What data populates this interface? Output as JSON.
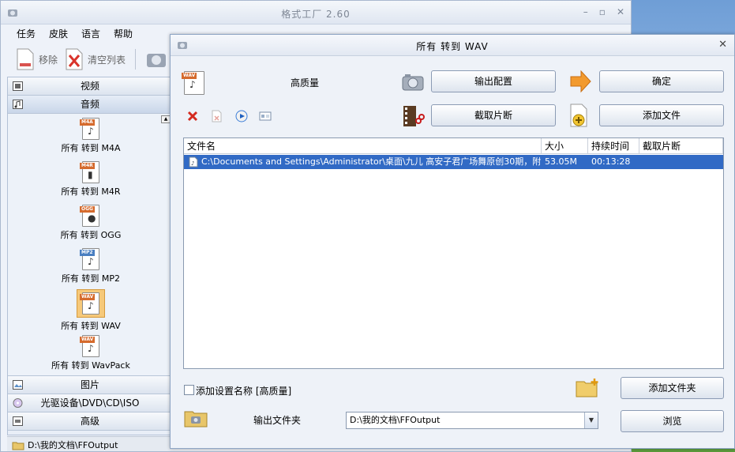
{
  "main_window": {
    "title": "格式工厂 2.60",
    "controls": {
      "minimize": "–",
      "maximize": "▫",
      "close": "✕"
    },
    "menu": [
      "任务",
      "皮肤",
      "语言",
      "帮助"
    ],
    "toolbar": {
      "remove": "移除",
      "clear_list": "清空列表"
    }
  },
  "sidebar": {
    "categories_top": [
      {
        "label": "视频",
        "icon": "film-icon"
      },
      {
        "label": "音频",
        "icon": "music-note-icon"
      }
    ],
    "formats": [
      {
        "tag": "M4A",
        "label": "所有 转到 M4A"
      },
      {
        "tag": "M4R",
        "label": "所有 转到 M4R"
      },
      {
        "tag": "OGG",
        "label": "所有 转到 OGG"
      },
      {
        "tag": "MP2",
        "label": "所有 转到 MP2"
      },
      {
        "tag": "WAV",
        "label": "所有 转到 WAV",
        "selected": true
      },
      {
        "tag": "WAV",
        "label": "所有 转到 WavPack"
      }
    ],
    "categories_bottom": [
      {
        "label": "图片",
        "icon": "picture-icon"
      },
      {
        "label": "光驱设备\\DVD\\CD\\ISO",
        "icon": "disc-icon"
      },
      {
        "label": "高级",
        "icon": "advanced-icon"
      }
    ]
  },
  "status": {
    "output_path": "D:\\我的文档\\FFOutput"
  },
  "dialog": {
    "title": "所有 转到 WAV",
    "close": "✕",
    "format_tag": "WAV",
    "quality": "高质量",
    "buttons": {
      "output_settings": "输出配置",
      "ok": "确定",
      "clip": "截取片断",
      "add_file": "添加文件",
      "add_folder": "添加文件夹",
      "browse": "浏览"
    },
    "list": {
      "columns": [
        "文件名",
        "大小",
        "持续时间",
        "截取片断"
      ],
      "rows": [
        {
          "file": "C:\\Documents and Settings\\Administrator\\桌面\\九儿 高安子君广场舞原创30期，附…",
          "size": "53.05M",
          "duration": "00:13:28",
          "clip": ""
        }
      ]
    },
    "add_setting_name": "添加设置名称 [高质量]",
    "output_folder_label": "输出文件夹",
    "output_folder_value": "D:\\我的文档\\FFOutput"
  }
}
